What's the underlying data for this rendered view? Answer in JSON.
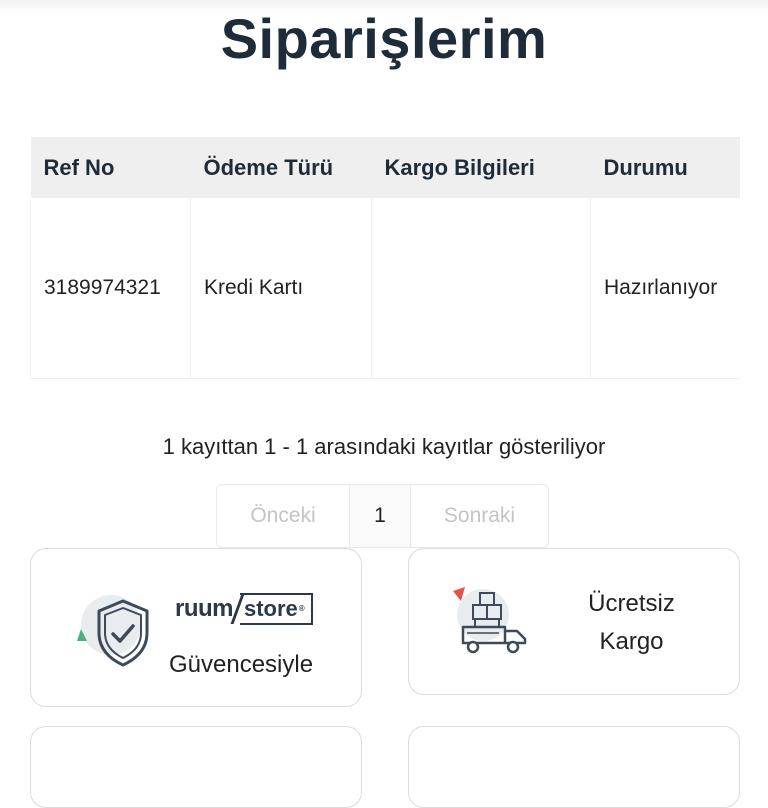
{
  "page": {
    "title": "Siparişlerim"
  },
  "orders_table": {
    "columns": [
      "Ref No",
      "Ödeme Türü",
      "Kargo Bilgileri",
      "Durumu"
    ],
    "rows": [
      {
        "ref_no": "3189974321",
        "payment_type": "Kredi Kartı",
        "shipping_info": "",
        "status": "Hazırlanıyor"
      }
    ]
  },
  "pagination": {
    "info": "1 kayıttan 1 - 1 arasındaki kayıtlar gösteriliyor",
    "prev_label": "Önceki",
    "current_page": "1",
    "next_label": "Sonraki"
  },
  "features": {
    "guarantee": {
      "brand_name": "ruum",
      "brand_suffix": "store",
      "brand_mark": "®",
      "label": "Güvencesiyle",
      "icon": "shield-check-icon"
    },
    "shipping": {
      "line1": "Ücretsiz",
      "line2": "Kargo",
      "icon": "delivery-truck-icon"
    }
  },
  "colors": {
    "title": "#1e2c3a",
    "table_header_bg": "#efefef",
    "icon_accent_green": "#4caf7d",
    "icon_accent_red": "#e8514a",
    "icon_stroke": "#3c4a5c"
  }
}
